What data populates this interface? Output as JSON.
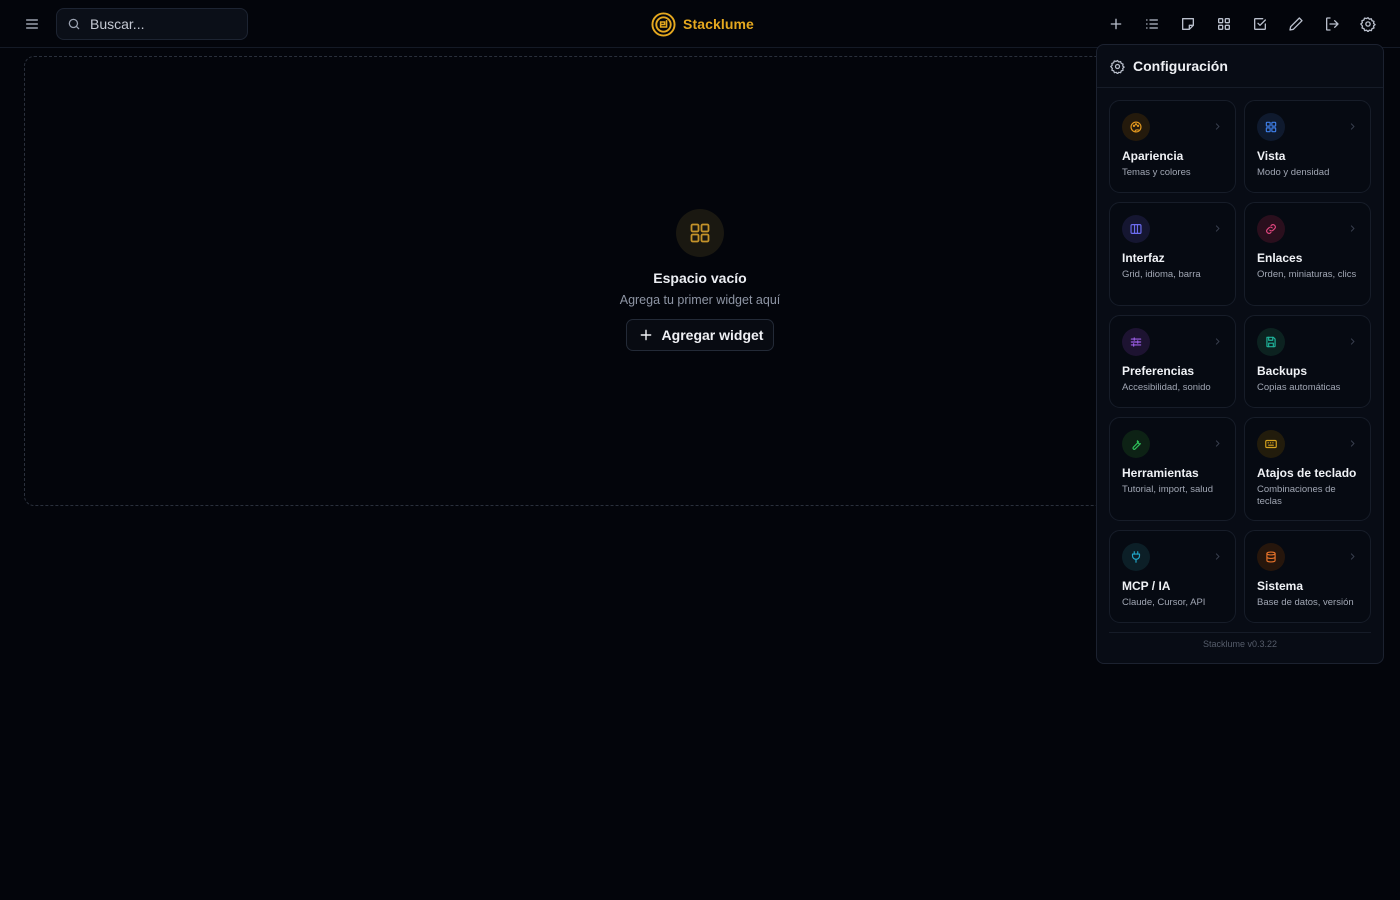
{
  "app": {
    "name": "Stacklume",
    "version_label": "Stacklume v0.3.22"
  },
  "search": {
    "placeholder": "Buscar..."
  },
  "empty_state": {
    "title": "Espacio vacío",
    "subtitle": "Agrega tu primer widget aquí",
    "add_button_label": "Agregar widget"
  },
  "settings": {
    "title": "Configuración",
    "items": [
      {
        "title": "Apariencia",
        "desc": "Temas y colores",
        "icon": "palette-icon",
        "color": "#e59a1f",
        "bg": "#241a0c"
      },
      {
        "title": "Vista",
        "desc": "Modo y densidad",
        "icon": "grid-icon",
        "color": "#3f7ee8",
        "bg": "#0f1a2e"
      },
      {
        "title": "Interfaz",
        "desc": "Grid, idioma, barra",
        "icon": "columns-icon",
        "color": "#6c6cf0",
        "bg": "#151631"
      },
      {
        "title": "Enlaces",
        "desc": "Orden, miniaturas, clics",
        "icon": "link-icon",
        "color": "#e0467f",
        "bg": "#2a0f1d"
      },
      {
        "title": "Preferencias",
        "desc": "Accesibilidad, sonido",
        "icon": "sliders-icon",
        "color": "#9b5de5",
        "bg": "#1d1331"
      },
      {
        "title": "Backups",
        "desc": "Copias automáticas",
        "icon": "save-icon",
        "color": "#1fb39a",
        "bg": "#0c2220"
      },
      {
        "title": "Herramientas",
        "desc": "Tutorial, import, salud",
        "icon": "wrench-icon",
        "color": "#2ec05a",
        "bg": "#0d2215"
      },
      {
        "title": "Atajos de teclado",
        "desc": "Combinaciones de teclas",
        "icon": "keyboard-icon",
        "color": "#d6a21e",
        "bg": "#221c0c"
      },
      {
        "title": "MCP / IA",
        "desc": "Claude, Cursor, API",
        "icon": "plug-icon",
        "color": "#22a7c9",
        "bg": "#0c1f27"
      },
      {
        "title": "Sistema",
        "desc": "Base de datos, versión",
        "icon": "database-icon",
        "color": "#e5722a",
        "bg": "#26160c"
      }
    ]
  },
  "toolbar": {
    "tools": [
      "plus-icon",
      "list-icon",
      "sticky-note-icon",
      "grid-icon",
      "checkbox-icon",
      "pencil-icon",
      "logout-icon",
      "gear-icon"
    ]
  }
}
